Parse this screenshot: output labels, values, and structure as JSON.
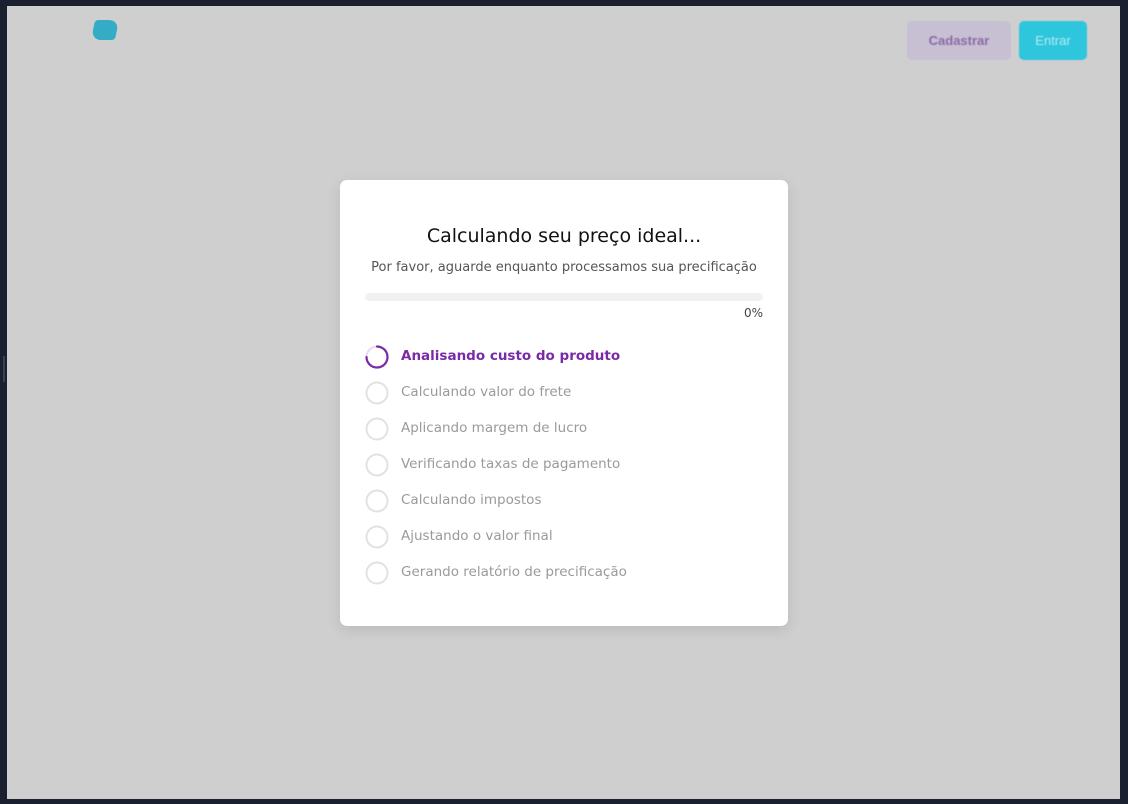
{
  "header": {
    "logo_icon": "logo-icon",
    "signup_label": "Cadastrar",
    "login_label": "Entrar"
  },
  "modal": {
    "title": "Calculando seu preço ideal...",
    "subtitle": "Por favor, aguarde enquanto processamos sua precificação",
    "progress": {
      "value": 0,
      "label": "0%"
    },
    "steps": [
      {
        "label": "Analisando custo do produto",
        "status": "in-progress",
        "icon": "spinner-icon"
      },
      {
        "label": "Calculando valor do frete",
        "status": "pending",
        "icon": "empty-circle-icon"
      },
      {
        "label": "Aplicando margem de lucro",
        "status": "pending",
        "icon": "empty-circle-icon"
      },
      {
        "label": "Verificando taxas de pagamento",
        "status": "pending",
        "icon": "empty-circle-icon"
      },
      {
        "label": "Calculando impostos",
        "status": "pending",
        "icon": "empty-circle-icon"
      },
      {
        "label": "Ajustando o valor final",
        "status": "pending",
        "icon": "empty-circle-icon"
      },
      {
        "label": "Gerando relatório de precificação",
        "status": "pending",
        "icon": "empty-circle-icon"
      }
    ]
  },
  "colors": {
    "accent": "#7a2aa6",
    "overlay": "#cfcfcf",
    "pending_text": "#9a9a9a",
    "pending_circle": "#e2e2e2",
    "login_button": "#2ec6dc"
  }
}
